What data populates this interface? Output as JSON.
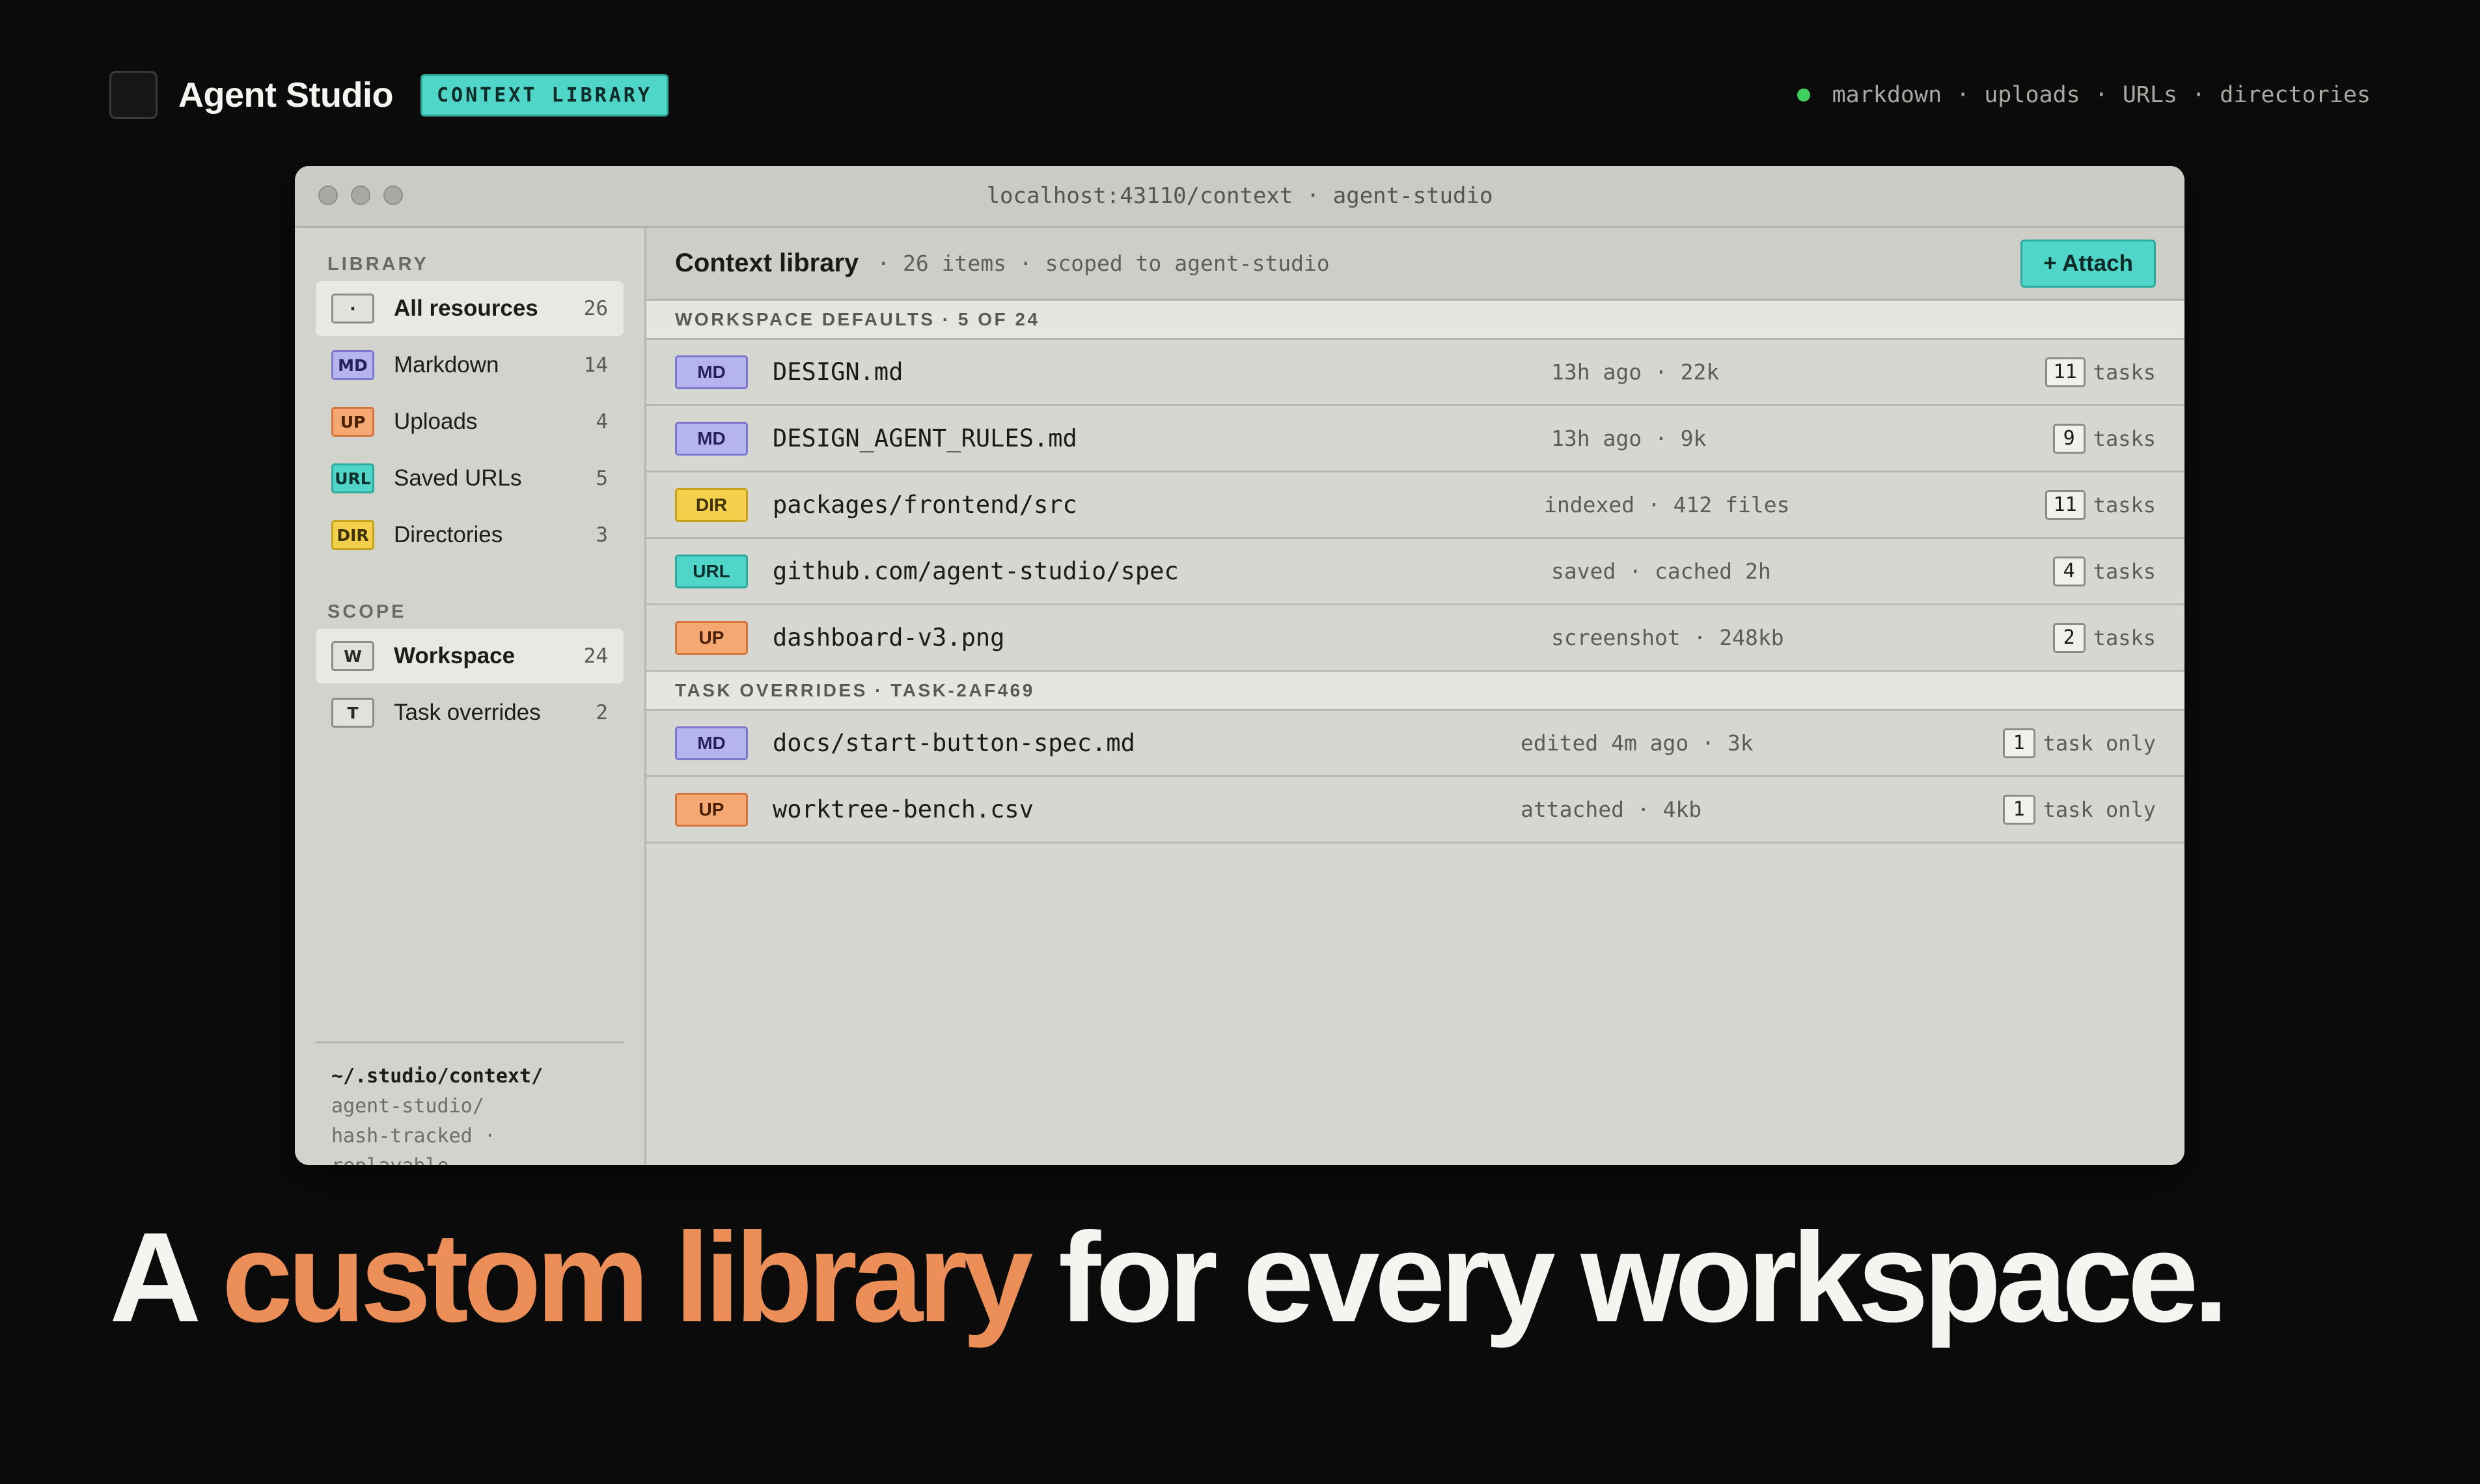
{
  "header": {
    "app_name": "Agent Studio",
    "badge": "CONTEXT LIBRARY",
    "status_items": [
      "markdown",
      "·",
      "uploads",
      "·",
      "URLs",
      "·",
      "directories"
    ]
  },
  "window": {
    "url": "localhost:43110/context · agent-studio"
  },
  "sidebar": {
    "library_label": "LIBRARY",
    "library_items": [
      {
        "tag": "·",
        "label": "All resources",
        "count": "26"
      },
      {
        "tag": "MD",
        "label": "Markdown",
        "count": "14"
      },
      {
        "tag": "UP",
        "label": "Uploads",
        "count": "4"
      },
      {
        "tag": "URL",
        "label": "Saved URLs",
        "count": "5"
      },
      {
        "tag": "DIR",
        "label": "Directories",
        "count": "3"
      }
    ],
    "scope_label": "SCOPE",
    "scope_items": [
      {
        "tag": "W",
        "label": "Workspace",
        "count": "24"
      },
      {
        "tag": "T",
        "label": "Task overrides",
        "count": "2"
      }
    ],
    "footer": {
      "path": "~/.studio/context/",
      "line2": "agent-studio/",
      "line3": "hash-tracked ·",
      "line4": "replayable"
    }
  },
  "main": {
    "title": "Context library",
    "meta": "· 26 items · scoped to agent-studio",
    "attach_label": "+ Attach",
    "groups": [
      {
        "title": "WORKSPACE DEFAULTS · 5 OF 24",
        "rows": [
          {
            "tag": "MD",
            "name": "DESIGN.md",
            "meta": "13h ago · 22k",
            "count": "11",
            "unit": "tasks"
          },
          {
            "tag": "MD",
            "name": "DESIGN_AGENT_RULES.md",
            "meta": "13h ago · 9k",
            "count": "9",
            "unit": "tasks"
          },
          {
            "tag": "DIR",
            "name": "packages/frontend/src",
            "meta": "indexed · 412 files",
            "count": "11",
            "unit": "tasks"
          },
          {
            "tag": "URL",
            "name": "github.com/agent-studio/spec",
            "meta": "saved · cached 2h",
            "count": "4",
            "unit": "tasks"
          },
          {
            "tag": "UP",
            "name": "dashboard-v3.png",
            "meta": "screenshot · 248kb",
            "count": "2",
            "unit": "tasks"
          }
        ]
      },
      {
        "title": "TASK OVERRIDES · TASK-2AF469",
        "rows": [
          {
            "tag": "MD",
            "name": "docs/start-button-spec.md",
            "meta": "edited 4m ago · 3k",
            "count": "1",
            "unit": "task only"
          },
          {
            "tag": "UP",
            "name": "worktree-bench.csv",
            "meta": "attached · 4kb",
            "count": "1",
            "unit": "task only"
          }
        ]
      }
    ]
  },
  "headline": {
    "part1": "A ",
    "accent": "custom library",
    "part2": " for every workspace."
  }
}
